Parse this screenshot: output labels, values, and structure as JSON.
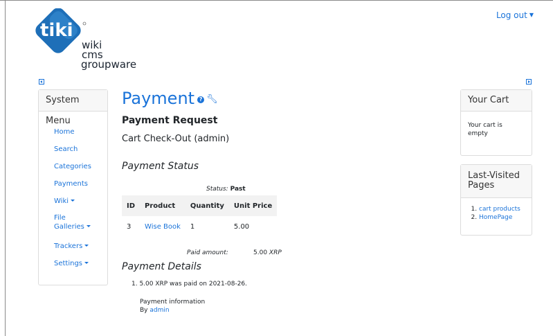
{
  "logo": {
    "brand": "tiki",
    "lines": [
      "wiki",
      "cms",
      "groupware"
    ]
  },
  "header": {
    "logout": "Log out"
  },
  "system_menu": {
    "title": "System Menu",
    "items": [
      {
        "label": "Home"
      },
      {
        "label": "Search"
      },
      {
        "label": "Categories"
      },
      {
        "label": "Payments"
      },
      {
        "label": "Wiki"
      },
      {
        "label": "File",
        "label2": "Galleries"
      },
      {
        "label": "Trackers"
      },
      {
        "label": "Settings"
      }
    ]
  },
  "main": {
    "title": "Payment",
    "subtitle": "Payment Request",
    "checkout": "Cart Check-Out (admin)",
    "status_heading": "Payment Status",
    "status_label": "Status:",
    "status_value": "Past",
    "table": {
      "headers": [
        "ID",
        "Product",
        "Quantity",
        "Unit Price"
      ],
      "rows": [
        [
          "3",
          "Wise Book",
          "1",
          "5.00"
        ]
      ]
    },
    "paid_label": "Paid amount:",
    "paid_amount": "5.00",
    "paid_currency": "XRP",
    "details_heading": "Payment Details",
    "details_item": "5.00 XRP was paid on 2021-08-26.",
    "info_label": "Payment information",
    "by_label": "By",
    "by_user": "admin"
  },
  "cart": {
    "title": "Your Cart",
    "empty_text_1": "Your cart is",
    "empty_text_2": "empty"
  },
  "last_visited": {
    "title_1": "Last-Visited",
    "title_2": "Pages",
    "items": [
      "cart products",
      "HomePage"
    ]
  },
  "colors": {
    "link": "#1a73d9",
    "logo_blue": "#1e6fb8"
  }
}
